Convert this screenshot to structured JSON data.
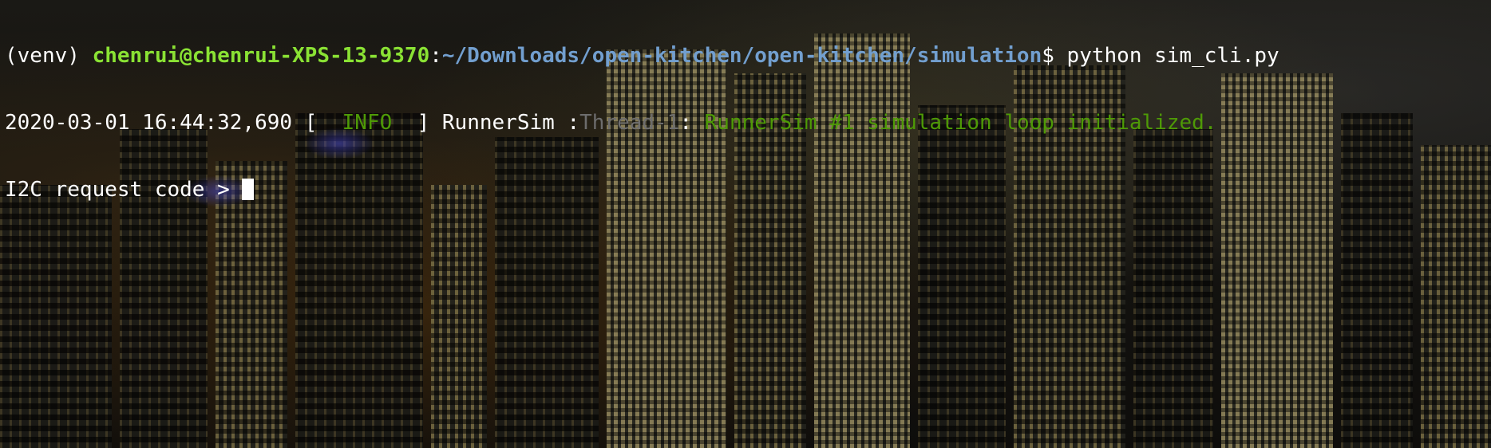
{
  "terminal": {
    "prompt": {
      "venv": "(venv)",
      "user_host": "chenrui@chenrui-XPS-13-9370",
      "separator": ":",
      "path": "~/Downloads/open-kitchen/open-kitchen/simulation",
      "symbol": "$",
      "command": "python sim_cli.py"
    },
    "log": {
      "timestamp": "2020-03-01 16:44:32,690",
      "bracket_open": "[",
      "level": "INFO",
      "bracket_close": "]",
      "logger": "RunnerSim",
      "logger_sep": ":",
      "thread": "Thread-1",
      "thread_sep": ":",
      "message": "RunnerSim #1 simulation loop initialized."
    },
    "input_prompt": "I2C request code >"
  },
  "colors": {
    "user_host": "#8ae234",
    "path": "#729fcf",
    "info": "#4e9a06",
    "thread": "#6d6d6d",
    "text": "#ffffff"
  },
  "background": "night-city-skyline-wallpaper"
}
